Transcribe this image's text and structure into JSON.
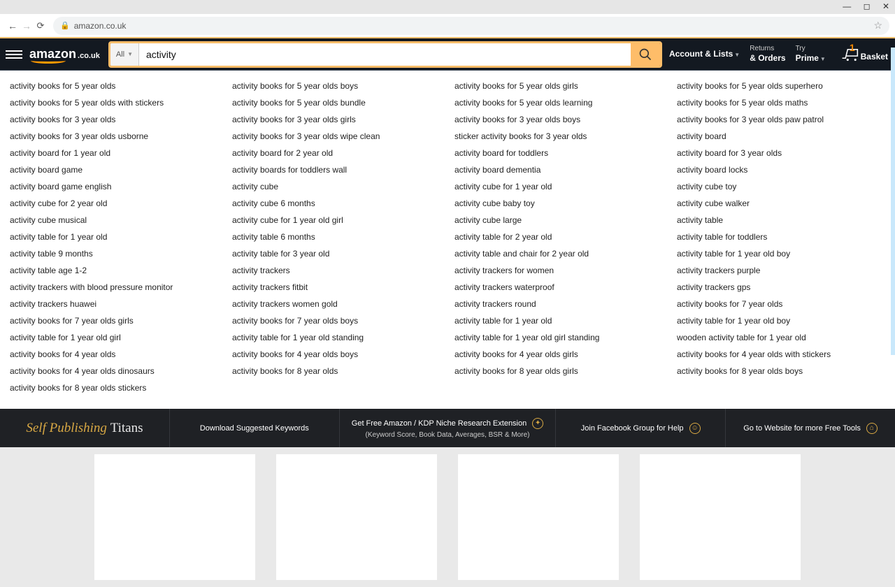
{
  "browser": {
    "url": "amazon.co.uk"
  },
  "header": {
    "logo_main": "amazon",
    "logo_tld": ".co.uk",
    "search_cat": "All",
    "search_value": "activity",
    "account": {
      "top": "",
      "bot": "Account & Lists"
    },
    "returns": {
      "top": "Returns",
      "bot": "& Orders"
    },
    "prime": {
      "top": "Try",
      "bot": "Prime"
    },
    "cart_count": "1",
    "cart_label": "Basket"
  },
  "suggestions": [
    "activity books for 5 year olds",
    "activity books for 5 year olds with stickers",
    "activity books for 3 year olds",
    "activity books for 3 year olds usborne",
    "activity board for 1 year old",
    "activity board game",
    "activity board game english",
    "activity cube for 2 year old",
    "activity cube musical",
    "activity table for 1 year old",
    "activity table 9 months",
    "activity table age 1-2",
    "activity trackers with blood pressure monitor",
    "activity trackers huawei",
    "activity books for 7 year olds girls",
    "activity table for 1 year old girl",
    "activity books for 4 year olds",
    "activity books for 4 year olds dinosaurs",
    "activity books for 8 year olds stickers",
    "activity books for 5 year olds boys",
    "activity books for 5 year olds bundle",
    "activity books for 3 year olds girls",
    "activity books for 3 year olds wipe clean",
    "activity board for 2 year old",
    "activity boards for toddlers wall",
    "activity cube",
    "activity cube 6 months",
    "activity cube for 1 year old girl",
    "activity table 6 months",
    "activity table for 3 year old",
    "activity trackers",
    "activity trackers fitbit",
    "activity trackers women gold",
    "activity books for 7 year olds boys",
    "activity table for 1 year old standing",
    "activity books for 4 year olds boys",
    "activity books for 8 year olds",
    "",
    "activity books for 5 year olds girls",
    "activity books for 5 year olds learning",
    "activity books for 3 year olds boys",
    "sticker activity books for 3 year olds",
    "activity board for toddlers",
    "activity board dementia",
    "activity cube for 1 year old",
    "activity cube baby toy",
    "activity cube large",
    "activity table for 2 year old",
    "activity table and chair for 2 year old",
    "activity trackers for women",
    "activity trackers waterproof",
    "activity trackers round",
    "activity table for 1 year old",
    "activity table for 1 year old girl standing",
    "activity books for 4 year olds girls",
    "activity books for 8 year olds girls",
    "",
    "activity books for 5 year olds superhero",
    "activity books for 5 year olds maths",
    "activity books for 3 year olds paw patrol",
    "activity board",
    "activity board for 3 year olds",
    "activity board locks",
    "activity cube toy",
    "activity cube walker",
    "activity table",
    "activity table for toddlers",
    "activity table for 1 year old boy",
    "activity trackers purple",
    "activity trackers gps",
    "activity books for 7 year olds",
    "activity table for 1 year old boy",
    "wooden activity table for 1 year old",
    "activity books for 4 year olds with stickers",
    "activity books for 8 year olds boys",
    ""
  ],
  "extbar": {
    "brand1": "Self Publishing ",
    "brand2": "Titans",
    "download": "Download Suggested Keywords",
    "ext_line1": "Get Free Amazon / KDP Niche Research Extension",
    "ext_line2": "(Keyword Score, Book Data, Averages, BSR & More)",
    "facebook": "Join Facebook Group for Help",
    "website": "Go to Website for more Free Tools"
  }
}
